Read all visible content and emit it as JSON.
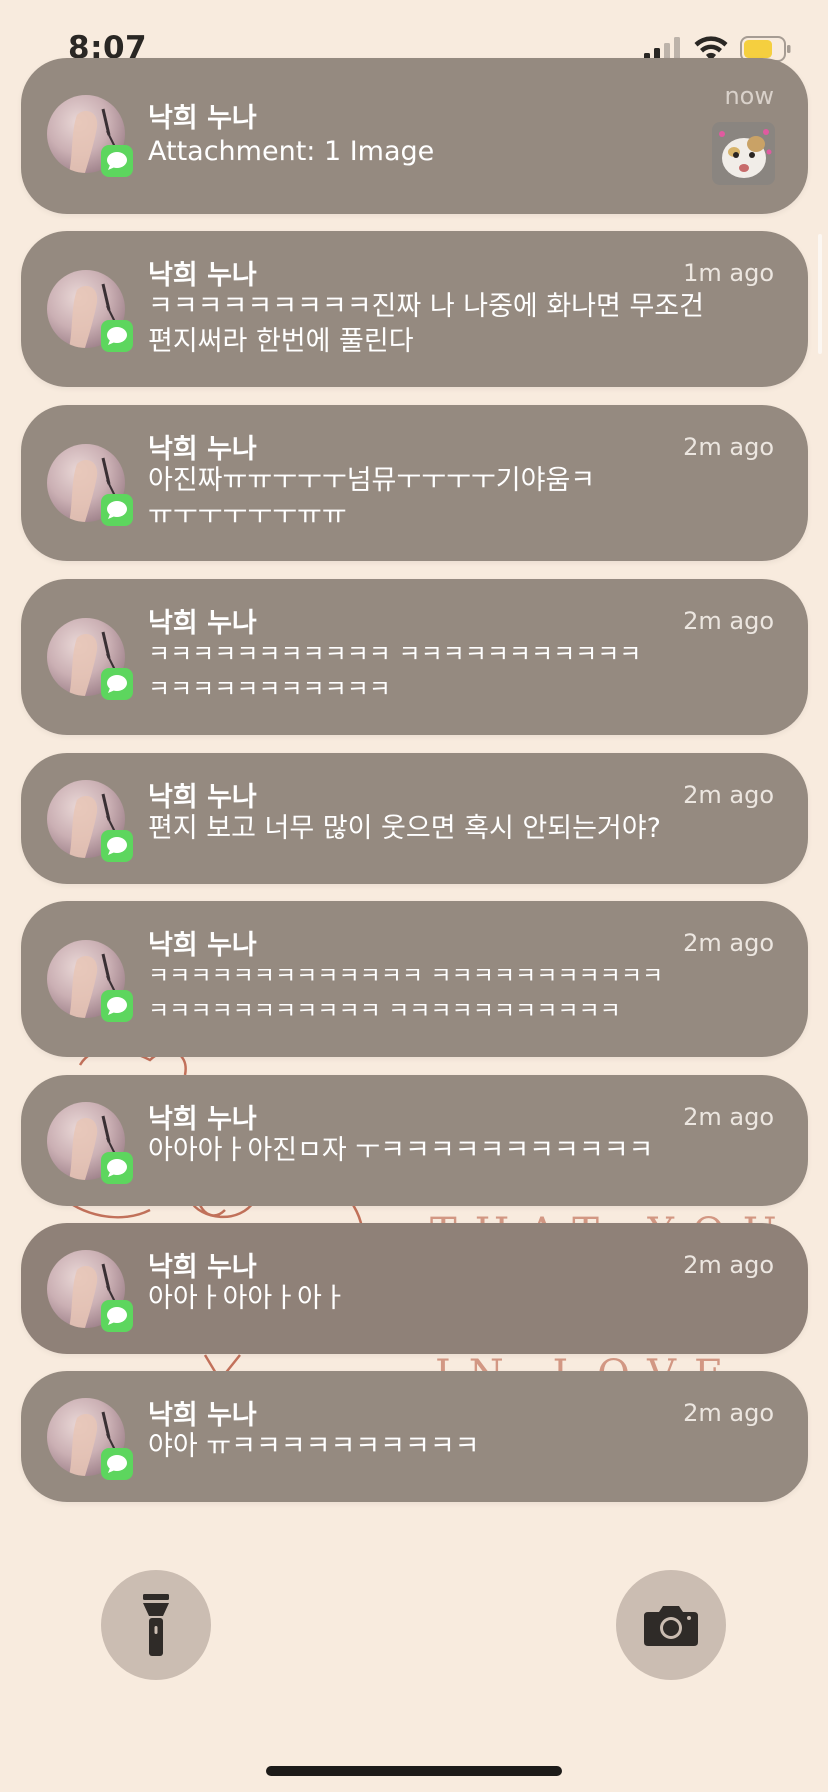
{
  "status_bar": {
    "time": "8:07",
    "icons": [
      "cellular-signal-icon",
      "wifi-icon",
      "battery-icon"
    ],
    "battery_color": "#f5cf3f"
  },
  "wallpaper": {
    "text_line1": "THAT YOU",
    "text_line2": "IN LOVE",
    "accent_color": "#b4533a"
  },
  "notifications": [
    {
      "sender": "낙희 누나",
      "time": "now",
      "body": "Attachment: 1 Image",
      "has_thumbnail": true
    },
    {
      "sender": "낙희 누나",
      "time": "1m ago",
      "body": "ㅋㅋㅋㅋㅋㅋㅋㅋㅋ진짜 나 나중에 화나면 무조건\n편지써라 한번에 풀린다"
    },
    {
      "sender": "낙희 누나",
      "time": "2m ago",
      "body": "아진짜ㅠㅠㅜㅜㅜ넘뮤ㅜㅜㅜㅜ기야움ㅋ\nㅠㅜㅜㅜㅜㅜㅠㅠ"
    },
    {
      "sender": "낙희 누나",
      "time": "2m ago",
      "body": "ㅋㅋㅋㅋㅋㅋㅋㅋㅋㅋㅋ ㅋㅋㅋㅋㅋㅋㅋㅋㅋㅋㅋ\nㅋㅋㅋㅋㅋㅋㅋㅋㅋㅋㅋ"
    },
    {
      "sender": "낙희 누나",
      "time": "2m ago",
      "body": "편지 보고 너무 많이 웃으면 혹시 안되는거야?"
    },
    {
      "sender": "낙희 누나",
      "time": "2m ago",
      "body": "ㅋㅋㅋㅋㅋㅋㅋㅋㅋㅋㅋㅋㅋ ㅋㅋㅋㅋㅋㅋㅋㅋㅋㅋㅋ\nㅋㅋㅋㅋㅋㅋㅋㅋㅋㅋㅋ ㅋㅋㅋㅋㅋㅋㅋㅋㅋㅋㅋ"
    },
    {
      "sender": "낙희 누나",
      "time": "2m ago",
      "body": "아아아ㅏ아진ㅁ자 ㅜㅋㅋㅋㅋㅋㅋㅋㅋㅋㅋㅋ"
    },
    {
      "sender": "낙희 누나",
      "time": "2m ago",
      "body": "아아ㅏ아아ㅏ아ㅏ"
    },
    {
      "sender": "낙희 누나",
      "time": "2m ago",
      "body": "야아 ㅠㅋㅋㅋㅋㅋㅋㅋㅋㅋㅋ"
    }
  ],
  "bottom_controls": {
    "left": "flashlight-icon",
    "right": "camera-icon"
  }
}
